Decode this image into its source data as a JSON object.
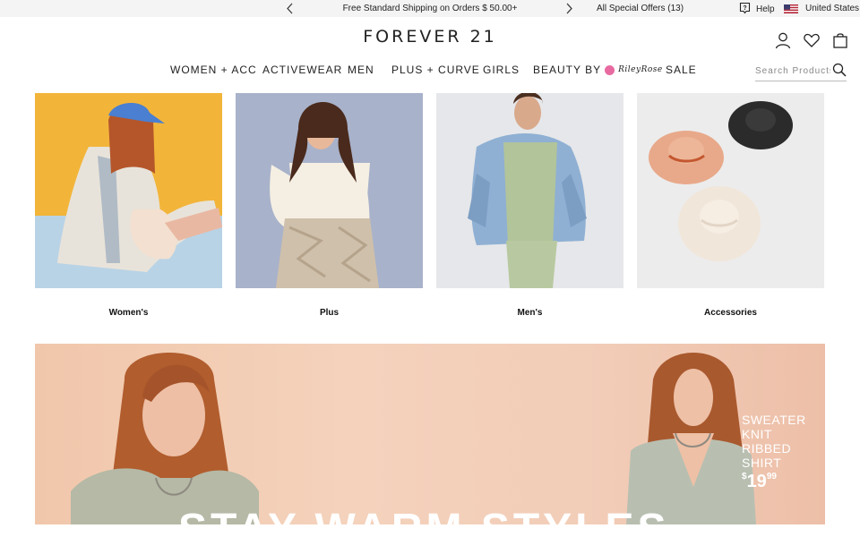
{
  "topbar": {
    "shipping": "Free Standard Shipping on Orders $ 50.00+",
    "offers": "All Special Offers (13)",
    "help": "Help",
    "country": "United States"
  },
  "header": {
    "logo": "FOREVER 21",
    "icons": [
      "account-icon",
      "heart-icon",
      "bag-icon"
    ]
  },
  "nav": {
    "items": [
      "WOMEN + ACC",
      "ACTIVEWEAR",
      "MEN",
      "PLUS + CURVE",
      "GIRLS",
      "BEAUTY BY",
      "SALE"
    ],
    "beauty_brand": "RileyRose"
  },
  "search": {
    "placeholder": "Search Products"
  },
  "categories": [
    {
      "label": "Women's"
    },
    {
      "label": "Plus"
    },
    {
      "label": "Men's"
    },
    {
      "label": "Accessories"
    }
  ],
  "hero": {
    "promo_line1": "SWEATER",
    "promo_line2": "KNIT RIBBED",
    "promo_line3": "SHIRT",
    "price_currency": "$",
    "price_dollars": "19",
    "price_cents": "99",
    "headline": "STAY WARM STYLES"
  },
  "colors": {
    "topbar_bg": "#f4f4f4",
    "text": "#222222",
    "hero_bg": "#f2cdb8",
    "riley_rose": "#e86aa0"
  }
}
